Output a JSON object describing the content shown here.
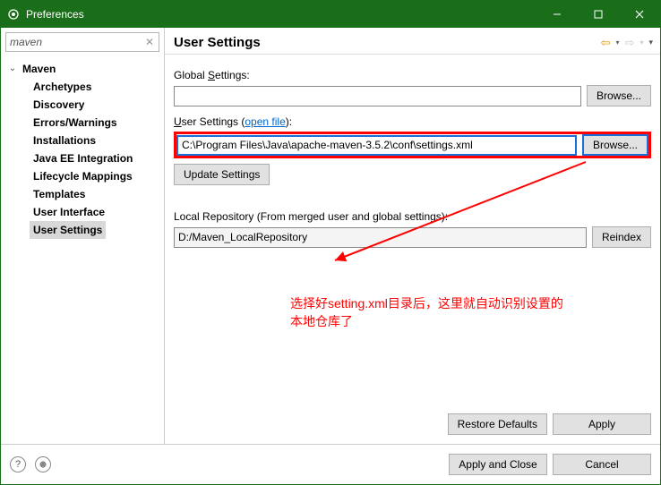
{
  "window": {
    "title": "Preferences"
  },
  "search": {
    "value": "maven"
  },
  "tree": {
    "root": "Maven",
    "items": [
      "Archetypes",
      "Discovery",
      "Errors/Warnings",
      "Installations",
      "Java EE Integration",
      "Lifecycle Mappings",
      "Templates",
      "User Interface",
      "User Settings"
    ],
    "selected": "User Settings"
  },
  "page": {
    "title": "User Settings",
    "global_label_pre": "Global ",
    "global_label_ul": "S",
    "global_label_post": "ettings:",
    "global_value": "",
    "browse": "Browse...",
    "user_label_pre": "",
    "user_label_ul": "U",
    "user_label_post": "ser Settings (",
    "user_link": "open file",
    "user_label_end": "):",
    "user_value": "C:\\Program Files\\Java\\apache-maven-3.5.2\\conf\\settings.xml",
    "update_btn": "Update Settings",
    "localrepo_label": "Local Repository (From merged user and global settings):",
    "localrepo_value": "D:/Maven_LocalRepository",
    "reindex": "Reindex",
    "restore": "Restore Defaults",
    "apply": "Apply"
  },
  "footer": {
    "apply_close": "Apply and Close",
    "cancel": "Cancel"
  },
  "annotation": {
    "text1": "选择好setting.xml目录后，这里就自动识别设置的",
    "text2": "本地仓库了"
  }
}
